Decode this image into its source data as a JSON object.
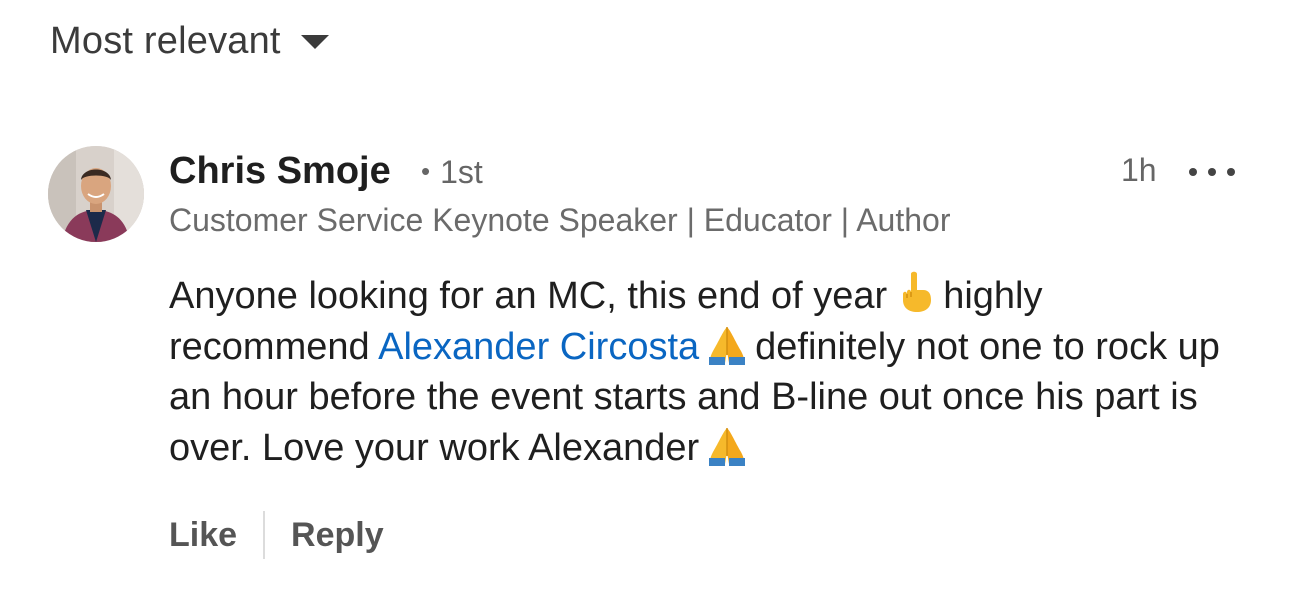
{
  "sort": {
    "label": "Most relevant",
    "icon": "caret-down-icon"
  },
  "comment": {
    "author": "Chris Smoje",
    "connection_degree": "1st",
    "separator": "•",
    "timestamp": "1h",
    "headline": "Customer Service Keynote Speaker | Educator | Author",
    "text_part1": "Anyone looking for an MC, this end of year",
    "text_part2": "highly recommend",
    "mention": "Alexander Circosta",
    "text_part3": "definitely not one to rock up an hour before the event starts and B-line out once his part is over. Love your work Alexander",
    "emojis": [
      "pointing-down-hand-emoji",
      "folded-hands-emoji",
      "folded-hands-emoji"
    ],
    "actions": {
      "like": "Like",
      "reply": "Reply"
    }
  },
  "colors": {
    "mention": "#0a66c2",
    "text": "#1f1f1f",
    "secondary": "#666666"
  }
}
